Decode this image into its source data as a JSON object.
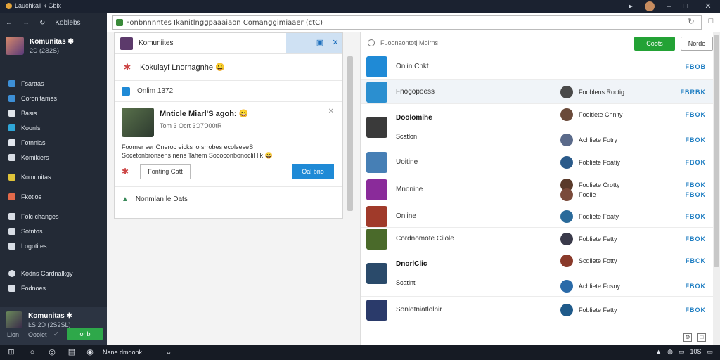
{
  "window": {
    "title": "Lauchkall k Gbix"
  },
  "url_bar": {
    "value": "Fonbnnnntes Ikanitlnggpaaaiaon Comanggimiaaer (ctC)"
  },
  "sidebar": {
    "profile": {
      "name": "Komunitas ✱",
      "sub": "2Ɔ (2Ƨ2S)"
    },
    "nav_title": "Koblebs",
    "items": [
      {
        "label": "Fsarttas",
        "icon": "store-icon",
        "color": "#3d8fd6"
      },
      {
        "label": "Coronitames",
        "icon": "community-icon",
        "color": "#3d8fd6"
      },
      {
        "label": "Basıs",
        "icon": "library-icon",
        "color": "#dfe4ea"
      },
      {
        "label": "Koonls",
        "icon": "downloads-icon",
        "color": "#2fa6d8"
      },
      {
        "label": "Fotnnlas",
        "icon": "friends-icon",
        "color": "#e1e6ee"
      },
      {
        "label": "Komikiers",
        "icon": "profile-icon",
        "color": "#d7dce4"
      },
      {
        "label": "Komunitas",
        "icon": "badges-icon",
        "color": "#e0c43a"
      },
      {
        "label": "Fkotlos",
        "icon": "photos-icon",
        "color": "#e36a4a"
      },
      {
        "label": "Folc changes",
        "icon": "changes-icon",
        "color": "#d8dde5"
      },
      {
        "label": "Sotntos",
        "icon": "settings-icon",
        "color": "#d8dde5"
      },
      {
        "label": "Logotites",
        "icon": "logout-icon",
        "color": "#d8dde5"
      },
      {
        "label": "Kodns Cardnalkgy",
        "icon": "friend-list-icon",
        "color": "#d8dde5"
      },
      {
        "label": "Fodnoes",
        "icon": "chat-icon",
        "color": "#d8dde5"
      }
    ],
    "bottom": {
      "name": "Komunitas ✱",
      "sub": "ĿS 2Ɔ (2S2SL)",
      "link1": "Lion",
      "link2": "Ooolet",
      "online_button": "onb"
    }
  },
  "middle": {
    "header_title": "Komuniites",
    "group_title": "Kokulayf Lnornagnhe 😀",
    "online_row": "Onlim 1372",
    "card": {
      "name": "Mnticle Miarl'S agoh: 😀",
      "sub": "Tom 3 Ocrt 3Ɔ7Ɔ00tR",
      "desc_line1": "Foomer ser Oneroc eicks io srrobes ecolseseS",
      "desc_line2": "Socetonbronsens nens Tahem Sococonbonoclil Ilk 😀",
      "ghost_button": "Fonting Gatt",
      "blue_button": "Oal bno"
    },
    "footer_row": "Nonmlan le Dats"
  },
  "right": {
    "search_placeholder": "Fuoonaontotj Moirns",
    "green_button": "Coots",
    "outline_button": "Norde",
    "rows": [
      {
        "name": "Onlin Chkt",
        "bold": false,
        "color": "#1f8ad6",
        "items": [
          {
            "label": "",
            "btn": "FBOB"
          }
        ]
      },
      {
        "name": "Fnogopoess",
        "bold": false,
        "color": "#2b8fd0",
        "items": [
          {
            "label": "Fooblens Roctig",
            "btn": "FBRBK",
            "avatar": "#4a4a4a"
          }
        ]
      },
      {
        "name": "Doolomihe",
        "sub": "Scatlon",
        "bold": true,
        "color": "#3a3a3a",
        "items": [
          {
            "label": "Fooltiete Chnity",
            "btn": "FBOK",
            "avatar": "#6a4a3a"
          },
          {
            "label": "Achliete Fotry",
            "btn": "FBOK",
            "avatar": "#5a6a8a"
          }
        ]
      },
      {
        "name": "Uoitine",
        "bold": false,
        "color": "#467fb5",
        "items": [
          {
            "label": "Fobliete Foatiy",
            "btn": "FBOK",
            "avatar": "#2a5a8a"
          }
        ]
      },
      {
        "name": "Mnonine",
        "bold": false,
        "color": "#8a2b9a",
        "items": [
          {
            "label": "Fodliete Crotty",
            "btn": "FBOK",
            "avatar": "#5a3a2a"
          },
          {
            "label": "Foolie",
            "btn": "FBOK",
            "avatar": "#7a4a3a"
          }
        ]
      },
      {
        "name": "Online",
        "bold": false,
        "color": "#a03a2a",
        "items": [
          {
            "label": "Fodliete Foaty",
            "btn": "FBOK",
            "avatar": "#2a6a9a"
          }
        ]
      },
      {
        "name": "Cordnomote Cilole",
        "bold": false,
        "color": "#4a6a2a",
        "items": [
          {
            "label": "Fobliete Fetty",
            "btn": "FBOK",
            "avatar": "#3a3a4a"
          }
        ]
      },
      {
        "name": "DnorlClic",
        "sub": "Scatint",
        "bold": true,
        "color": "#2a4a6a",
        "items": [
          {
            "label": "Scdliete Fotty",
            "btn": "FBCK",
            "avatar": "#8a3a2a"
          },
          {
            "label": "Achliete Fosny",
            "btn": "FBOK",
            "avatar": "#2a6aa8"
          }
        ]
      },
      {
        "name": "Sonlotniatlolnir",
        "bold": false,
        "color": "#2a3a6a",
        "items": [
          {
            "label": "Fobliete Fatty",
            "btn": "FBOK",
            "avatar": "#1f5a8a"
          }
        ]
      }
    ]
  },
  "taskbar": {
    "app_label": "Nane dmdonk",
    "time": "10S"
  }
}
